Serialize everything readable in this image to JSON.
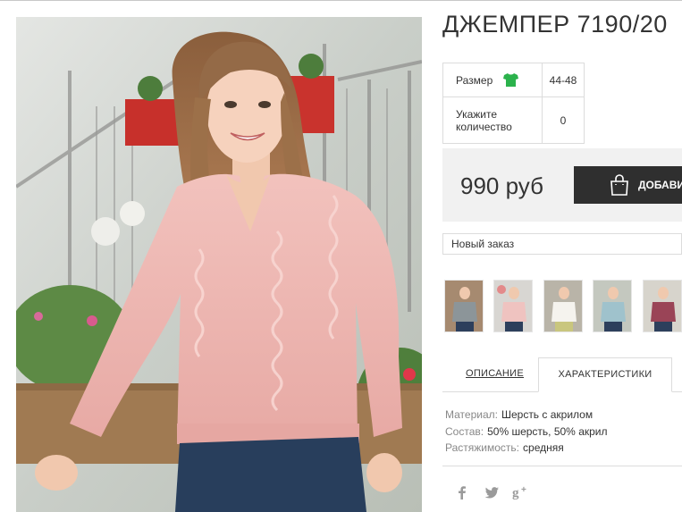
{
  "product": {
    "title": "ДЖЕМПЕР 7190/20"
  },
  "specs": {
    "size_label": "Размер",
    "size_value": "44-48",
    "qty_label_line1": "Укажите",
    "qty_label_line2": "количество",
    "qty_value": "0"
  },
  "purchase": {
    "price": "990 руб",
    "button_label": "ДОБАВИТ"
  },
  "order_select": {
    "selected": "Новый заказ"
  },
  "tabs": {
    "description": "ОПИСАНИЕ",
    "characteristics": "ХАРАКТЕРИСТИКИ"
  },
  "characteristics": [
    {
      "key": "Материал:",
      "value": "Шерсть с акрилом"
    },
    {
      "key": "Состав:",
      "value": "50% шерсть, 50% акрил"
    },
    {
      "key": "Растяжимость:",
      "value": "средняя"
    }
  ],
  "icons": {
    "size_guide": "tshirt-icon",
    "add_to_cart": "shopping-bag-icon",
    "social": [
      "facebook-icon",
      "twitter-icon",
      "google-plus-icon"
    ]
  },
  "colors": {
    "accent_green": "#2bb24c",
    "button_dark": "#2f2f2f",
    "sweater_pink": "#edb3b0"
  }
}
